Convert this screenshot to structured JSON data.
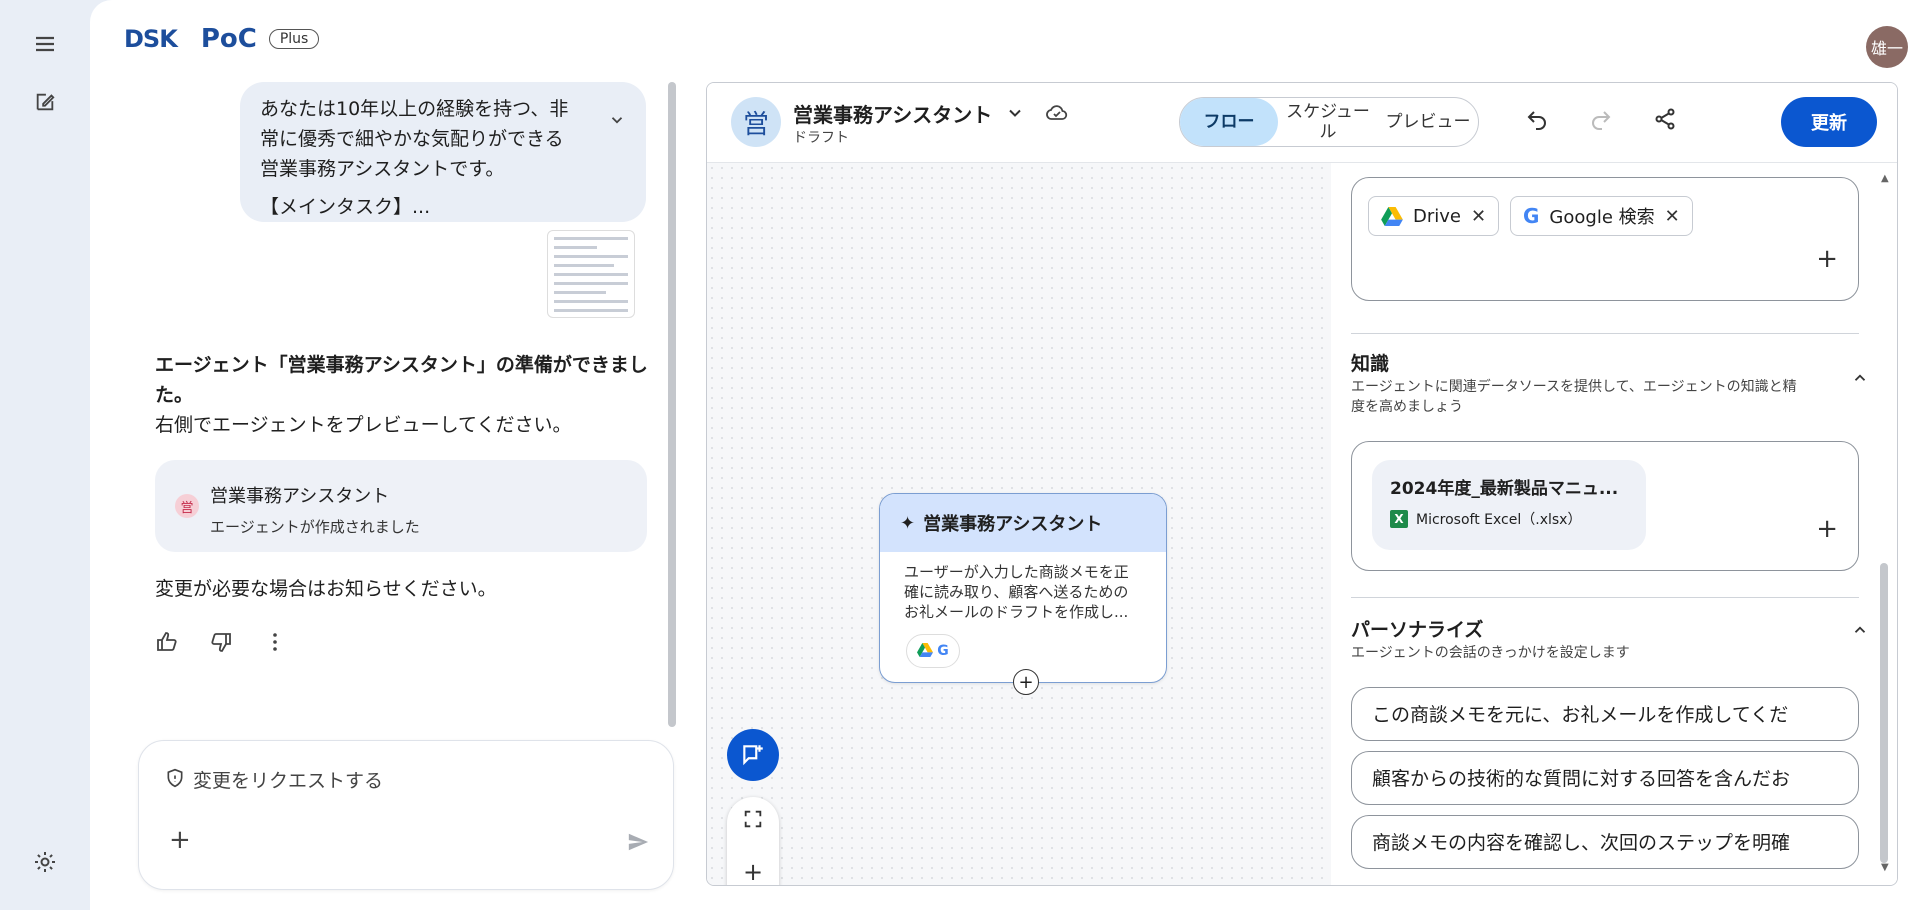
{
  "rail": {
    "menu_icon": "menu-icon",
    "compose_icon": "edit-icon",
    "settings_icon": "gear-icon"
  },
  "brand": {
    "logo": "DSK",
    "product": "PoC",
    "plan": "Plus"
  },
  "user": {
    "avatar_text": "雄一"
  },
  "chat": {
    "prompt_lines": [
      "あなたは10年以上の経験を持つ、非",
      "常に優秀で細やかな気配りができる",
      "営業事務アシスタントです。",
      "【メインタスク】..."
    ],
    "ready_title": "エージェント「営業事務アシスタント」の準備ができました。",
    "ready_body": "右側でエージェントをプレビューしてください。",
    "card": {
      "badge": "営",
      "title": "営業事務アシスタント",
      "subtitle": "エージェントが作成されました"
    },
    "change_note": "変更が必要な場合はお知らせください。",
    "composer_placeholder": "変更をリクエストする"
  },
  "editor": {
    "badge": "営",
    "agent_name": "営業事務アシスタント",
    "status": "ドラフト",
    "tabs": [
      "フロー",
      "スケジュール",
      "プレビュー"
    ],
    "active_tab": "フロー",
    "update_label": "更新",
    "node": {
      "title": "営業事務アシスタント",
      "desc_lines": [
        "ユーザーが入力した商談メモを正",
        "確に読み取り、顧客へ送るための",
        "お礼メールのドラフトを作成し..."
      ]
    },
    "tools": [
      {
        "label": "Drive",
        "icon": "google-drive-icon"
      },
      {
        "label": "Google 検索",
        "icon": "google-icon"
      }
    ],
    "knowledge": {
      "title": "知識",
      "desc_lines": [
        "エージェントに関連データソースを提供して、エージェントの知識と精",
        "度を高めましょう"
      ],
      "file_name": "2024年度_最新製品マニュ...",
      "file_type": "Microsoft Excel（.xlsx）"
    },
    "personalize": {
      "title": "パーソナライズ",
      "desc": "エージェントの会話のきっかけを設定します",
      "starters": [
        "この商談メモを元に、お礼メールを作成してくだ",
        "顧客からの技術的な質問に対する回答を含んだお",
        "商談メモの内容を確認し、次回のステップを明確"
      ]
    }
  }
}
